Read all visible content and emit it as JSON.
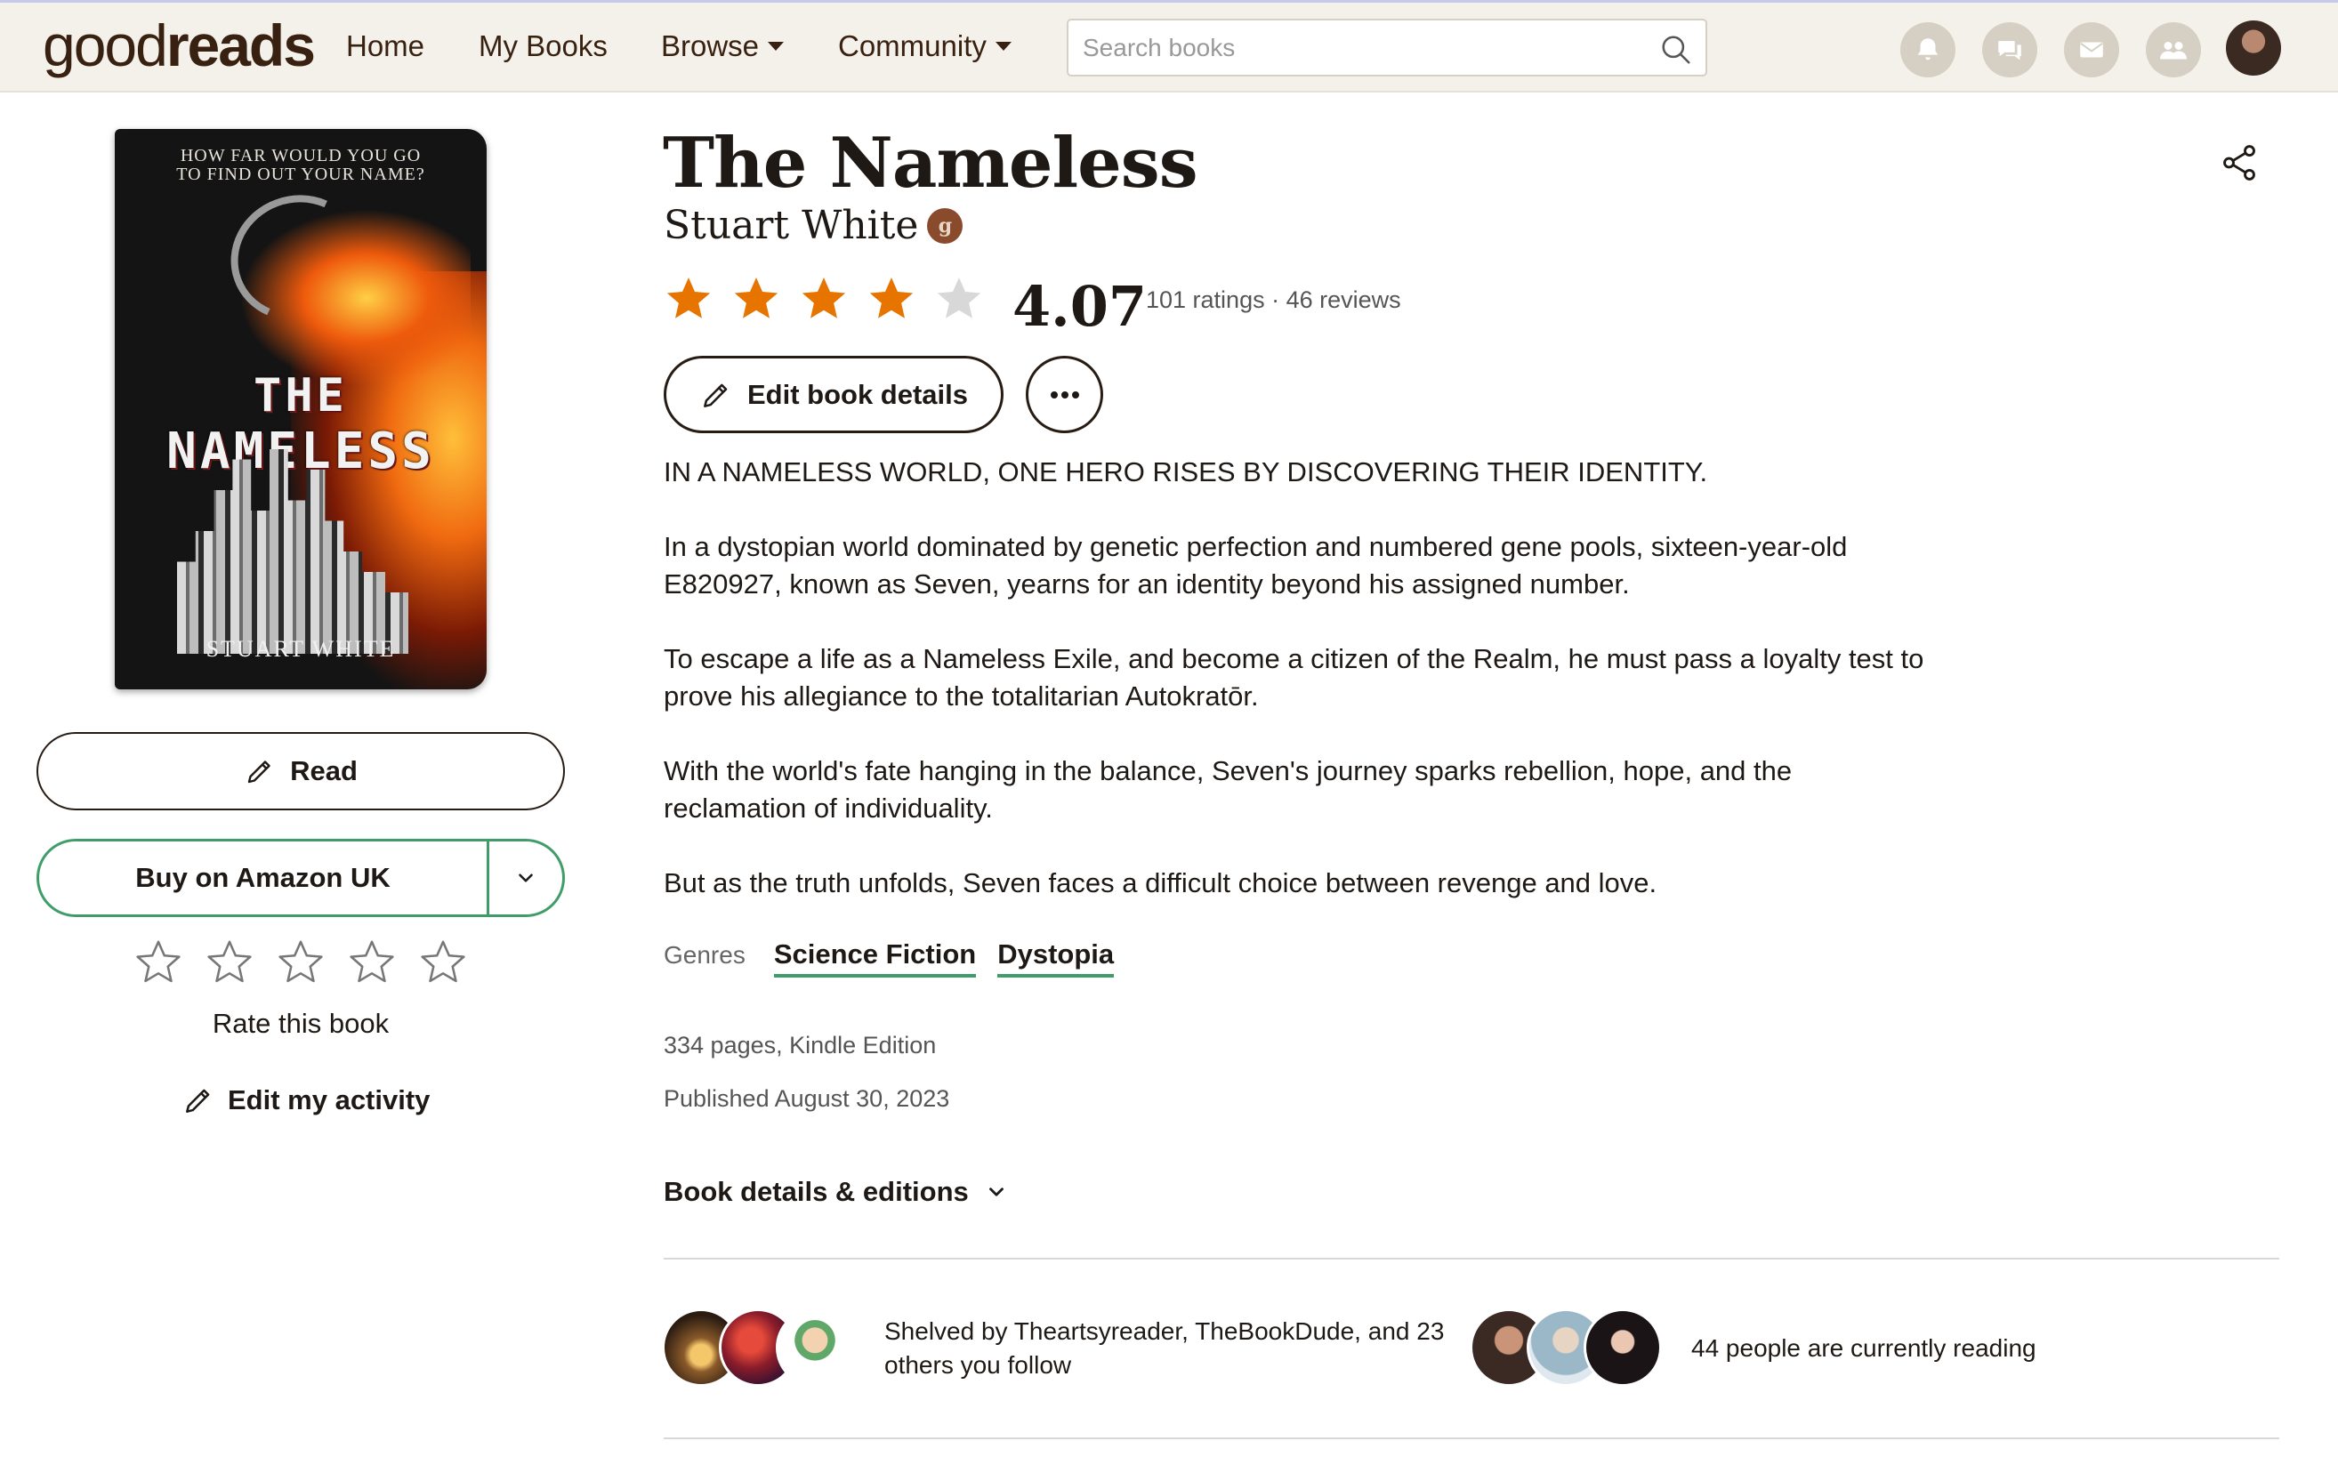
{
  "header": {
    "logo_light": "good",
    "logo_bold": "reads",
    "nav": [
      {
        "label": "Home"
      },
      {
        "label": "My Books"
      },
      {
        "label": "Browse"
      },
      {
        "label": "Community"
      }
    ],
    "search_placeholder": "Search books"
  },
  "cover": {
    "tagline": "HOW FAR WOULD YOU GO TO FIND OUT YOUR NAME?",
    "title_line1": "THE",
    "title_line2": "NAMELESS",
    "author": "STUART WHITE"
  },
  "actions": {
    "read_label": "Read",
    "buy_label": "Buy on Amazon UK",
    "rate_label": "Rate this book",
    "edit_activity_label": "Edit my activity"
  },
  "book": {
    "title": "The Nameless",
    "author": "Stuart White",
    "author_badge": "g",
    "average_rating": "4.07",
    "rating_value": 4.07,
    "ratings_text": "101 ratings · 46 reviews",
    "edit_details_label": "Edit book details",
    "description": [
      "IN A NAMELESS WORLD, ONE HERO RISES BY DISCOVERING THEIR IDENTITY.",
      "In a dystopian world dominated by genetic perfection and numbered gene pools, sixteen-year-old E820927, known as Seven, yearns for an identity beyond his assigned number.",
      "To escape a life as a Nameless Exile, and become a citizen of the Realm, he must pass a loyalty test to prove his allegiance to the totalitarian Autokratōr.",
      "With the world's fate hanging in the balance, Seven's journey sparks rebellion, hope, and the reclamation of individuality.",
      "But as the truth unfolds, Seven faces a difficult choice between revenge and love."
    ],
    "genres_label": "Genres",
    "genres": [
      "Science Fiction",
      "Dystopia"
    ],
    "pages_format": "334 pages, Kindle Edition",
    "published": "Published August 30, 2023",
    "details_toggle": "Book details & editions"
  },
  "social": {
    "shelved_text": "Shelved by Theartsyreader, TheBookDude, and 23 others you follow",
    "reading_text": "44 people are currently reading"
  },
  "colors": {
    "header_bg": "#f4f1ea",
    "accent_green": "#409d69",
    "star_orange": "#e87400",
    "star_empty": "#d8d8d8",
    "text_dark": "#1e1915"
  }
}
